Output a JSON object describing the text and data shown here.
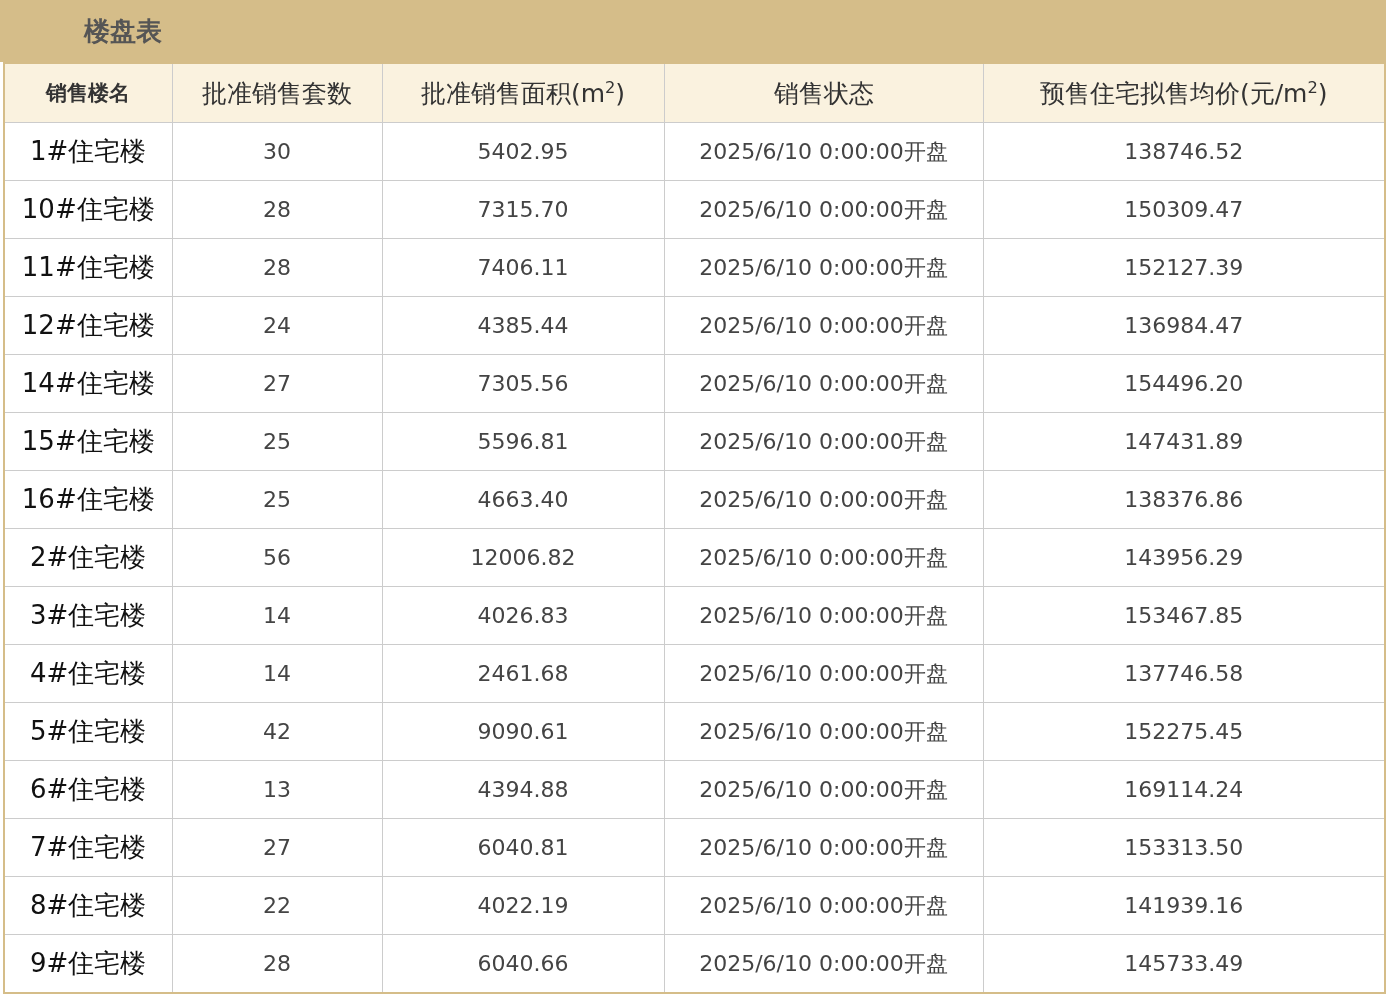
{
  "title": "楼盘表",
  "table": {
    "columns": [
      "销售楼名",
      "批准销售套数",
      "批准销售面积(m$^{2}$)",
      "销售状态",
      "预售住宅拟售均价(元/m$^{2}$)"
    ],
    "rows": [
      [
        "1#住宅楼",
        "30",
        "5402.95",
        "2025/6/10 0:00:00开盘",
        "138746.52"
      ],
      [
        "10#住宅楼",
        "28",
        "7315.70",
        "2025/6/10 0:00:00开盘",
        "150309.47"
      ],
      [
        "11#住宅楼",
        "28",
        "7406.11",
        "2025/6/10 0:00:00开盘",
        "152127.39"
      ],
      [
        "12#住宅楼",
        "24",
        "4385.44",
        "2025/6/10 0:00:00开盘",
        "136984.47"
      ],
      [
        "14#住宅楼",
        "27",
        "7305.56",
        "2025/6/10 0:00:00开盘",
        "154496.20"
      ],
      [
        "15#住宅楼",
        "25",
        "5596.81",
        "2025/6/10 0:00:00开盘",
        "147431.89"
      ],
      [
        "16#住宅楼",
        "25",
        "4663.40",
        "2025/6/10 0:00:00开盘",
        "138376.86"
      ],
      [
        "2#住宅楼",
        "56",
        "12006.82",
        "2025/6/10 0:00:00开盘",
        "143956.29"
      ],
      [
        "3#住宅楼",
        "14",
        "4026.83",
        "2025/6/10 0:00:00开盘",
        "153467.85"
      ],
      [
        "4#住宅楼",
        "14",
        "2461.68",
        "2025/6/10 0:00:00开盘",
        "137746.58"
      ],
      [
        "5#住宅楼",
        "42",
        "9090.61",
        "2025/6/10 0:00:00开盘",
        "152275.45"
      ],
      [
        "6#住宅楼",
        "13",
        "4394.88",
        "2025/6/10 0:00:00开盘",
        "169114.24"
      ],
      [
        "7#住宅楼",
        "27",
        "6040.81",
        "2025/6/10 0:00:00开盘",
        "153313.50"
      ],
      [
        "8#住宅楼",
        "22",
        "4022.19",
        "2025/6/10 0:00:00开盘",
        "141939.16"
      ],
      [
        "9#住宅楼",
        "28",
        "6040.66",
        "2025/6/10 0:00:00开盘",
        "145733.49"
      ]
    ]
  }
}
